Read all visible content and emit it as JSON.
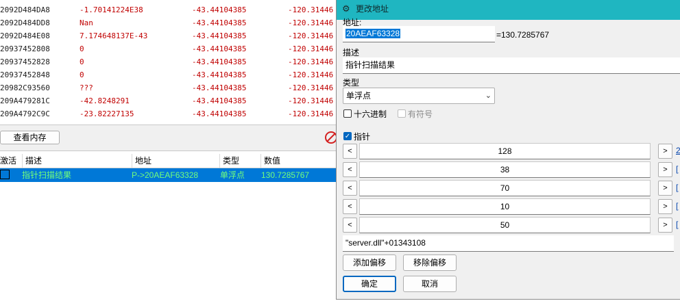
{
  "scan_results": {
    "rows": [
      {
        "address": "2092D484DA8",
        "value": "-1.70141224E38",
        "col3": "-43.44104385",
        "col4": "-120.31446"
      },
      {
        "address": "2092D484DD8",
        "value": "Nan",
        "col3": "-43.44104385",
        "col4": "-120.31446"
      },
      {
        "address": "2092D484E08",
        "value": "7.174648137E-43",
        "col3": "-43.44104385",
        "col4": "-120.31446"
      },
      {
        "address": "20937452808",
        "value": "0",
        "col3": "-43.44104385",
        "col4": "-120.31446"
      },
      {
        "address": "20937452828",
        "value": "0",
        "col3": "-43.44104385",
        "col4": "-120.31446"
      },
      {
        "address": "20937452848",
        "value": "0",
        "col3": "-43.44104385",
        "col4": "-120.31446"
      },
      {
        "address": "20982C93560",
        "value": "???",
        "col3": "-43.44104385",
        "col4": "-120.31446"
      },
      {
        "address": "209A479281C",
        "value": "-42.8248291",
        "col3": "-43.44104385",
        "col4": "-120.31446"
      },
      {
        "address": "209A4792C9C",
        "value": "-23.82227135",
        "col3": "-43.44104385",
        "col4": "-120.31446"
      }
    ]
  },
  "memory_toolbar": {
    "view_memory_label": "查看内存"
  },
  "address_table": {
    "headers": {
      "active": "激活",
      "description": "描述",
      "address": "地址",
      "type": "类型",
      "value": "数值"
    },
    "rows": [
      {
        "description": "指针扫描结果",
        "address": "P->20AEAF63328",
        "type": "单浮点",
        "value": "130.7285767"
      }
    ]
  },
  "dialog": {
    "title": "更改地址",
    "address_label": "地址:",
    "address_value": "20AEAF63328",
    "address_result": "=130.7285767",
    "description_label": "描述",
    "description_value": "指针扫描结果",
    "type_label": "类型",
    "type_value": "单浮点",
    "hex_label": "十六进制",
    "signed_label": "有符号",
    "pointer_label": "指针",
    "offsets": [
      {
        "value": "128",
        "link": "2"
      },
      {
        "value": "38",
        "link": "["
      },
      {
        "value": "70",
        "link": "["
      },
      {
        "value": "10",
        "link": "["
      },
      {
        "value": "50",
        "link": "["
      }
    ],
    "left_arrow": "<",
    "right_arrow": ">",
    "base_address": "\"server.dll\"+01343108",
    "add_offset_label": "添加偏移",
    "remove_offset_label": "移除偏移",
    "ok_label": "确定",
    "cancel_label": "取消"
  }
}
